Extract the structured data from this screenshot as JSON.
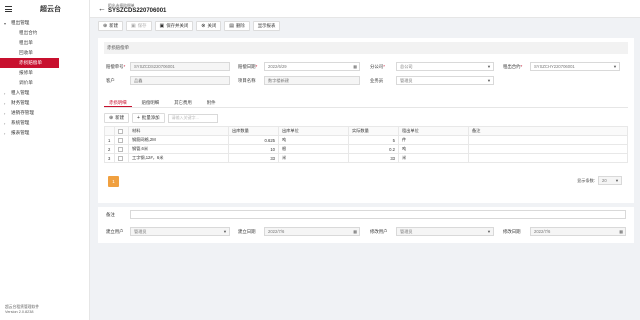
{
  "sidebar": {
    "title": "超云台",
    "groups": [
      {
        "caret": "▾",
        "label": "租出管理"
      },
      {
        "caret": "›",
        "label": "租入管理"
      },
      {
        "caret": "›",
        "label": "财务管理"
      },
      {
        "caret": "›",
        "label": "进销存管理"
      },
      {
        "caret": "›",
        "label": "系统管理"
      },
      {
        "caret": "›",
        "label": "报表管理"
      }
    ],
    "items": [
      "租出合约",
      "租出单",
      "回收单",
      "赤损赔偿单",
      "报修单",
      "调价单"
    ],
    "footer_line1": "超云台租赁管理软件",
    "footer_line2": "Version 2.0.8238"
  },
  "header": {
    "back_icon": "←",
    "breadcrumb": "租出赤损赔偿单",
    "doc_no": "SYSZCDS220706001"
  },
  "toolbar": {
    "new": "新建",
    "save": "保存",
    "save_close": "保存并关闭",
    "close": "关闭",
    "delete": "删除",
    "print": "显示报表"
  },
  "form": {
    "section_title": "赤损赔偿单",
    "doc_no_label": "赔偿单号",
    "doc_no_value": "SYSZCDS220706001",
    "date_label": "赔偿日期",
    "date_value": "2022/6/29",
    "company_label": "分公司",
    "company_value": "总公司",
    "contract_label": "租出合约",
    "contract_value": "SYSZCHY220706001",
    "customer_label": "客户",
    "customer_value": "品鑫",
    "project_label": "项目名称",
    "project_value": "数字楼新建",
    "salesman_label": "业务员",
    "salesman_value": "管理员"
  },
  "tabs": [
    "赤损明细",
    "赔偿明细",
    "其它费用",
    "附件"
  ],
  "detail_toolbar": {
    "new": "新建",
    "batch_add": "批量添加",
    "search_placeholder": "请输入关键字..."
  },
  "grid": {
    "headers": [
      "",
      "",
      "材料",
      "出库数量",
      "出库单位",
      "实际数量",
      "租出单位",
      "备注"
    ],
    "rows": [
      {
        "no": "1",
        "material": "钢筋网格,2M",
        "out_qty": "0.625",
        "out_unit": "吨",
        "actual_qty": "5",
        "unit": "件",
        "remark": ""
      },
      {
        "no": "2",
        "material": "钢管,6米",
        "out_qty": "10",
        "out_unit": "根",
        "actual_qty": "0.2",
        "unit": "吨",
        "remark": ""
      },
      {
        "no": "3",
        "material": "工字钢,12#，6米",
        "out_qty": "33",
        "out_unit": "米",
        "actual_qty": "33",
        "unit": "米",
        "remark": ""
      }
    ]
  },
  "pager": {
    "page": "1",
    "page_size_label": "显示条数:",
    "page_size": "20"
  },
  "footer_form": {
    "remark_label": "备注",
    "creator_label": "建立用户",
    "creator_value": "管理员",
    "created_label": "建立日期",
    "created_value": "2022/7/6",
    "modifier_label": "修改用户",
    "modifier_value": "管理员",
    "modified_label": "修改日期",
    "modified_value": "2022/7/6"
  },
  "colors": {
    "accent": "#c8102e",
    "pager": "#f0a040"
  }
}
